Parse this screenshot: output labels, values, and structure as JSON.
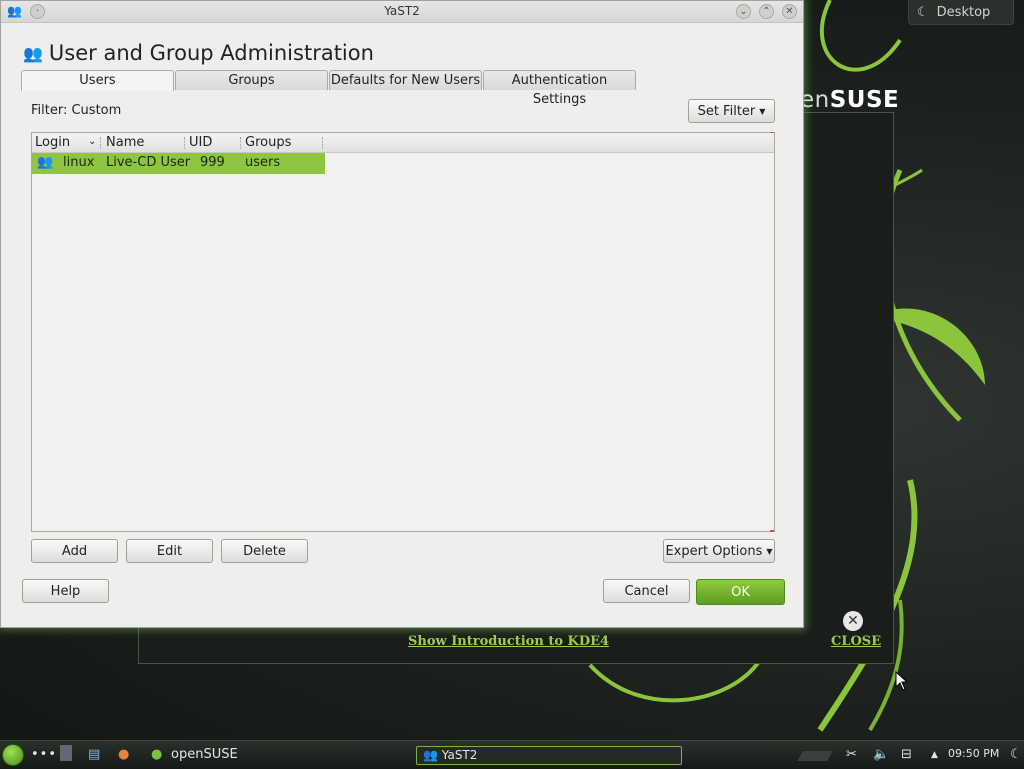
{
  "desktop": {
    "desktop_button": "Desktop",
    "brand_prefix": "en",
    "brand": "SUSE",
    "welcome_link": "Show Introduction to KDE4",
    "welcome_close": "CLOSE"
  },
  "window": {
    "title": "YaST2",
    "heading": "User and Group Administration"
  },
  "tabs": [
    {
      "label": "Users",
      "active": true
    },
    {
      "label": "Groups",
      "active": false
    },
    {
      "label": "Defaults for New Users",
      "active": false
    },
    {
      "label": "Authentication Settings",
      "active": false
    }
  ],
  "filter": {
    "label": "Filter: Custom",
    "set_filter": "Set Filter"
  },
  "table": {
    "columns": [
      "Login",
      "Name",
      "UID",
      "Groups"
    ],
    "rows": [
      {
        "login": "linux",
        "name": "Live-CD User",
        "uid": "999",
        "groups": "users",
        "selected": true
      }
    ]
  },
  "actions": {
    "add": "Add",
    "edit": "Edit",
    "delete": "Delete",
    "expert_options": "Expert Options"
  },
  "footer": {
    "help": "Help",
    "cancel": "Cancel",
    "ok": "OK"
  },
  "taskbar": {
    "start_label": "openSUSE",
    "task": "YaST2",
    "clock": "09:50 PM"
  },
  "colors": {
    "accent_green": "#8fc445",
    "ok_button": "#6aa826",
    "link_green": "#9ecb55"
  }
}
